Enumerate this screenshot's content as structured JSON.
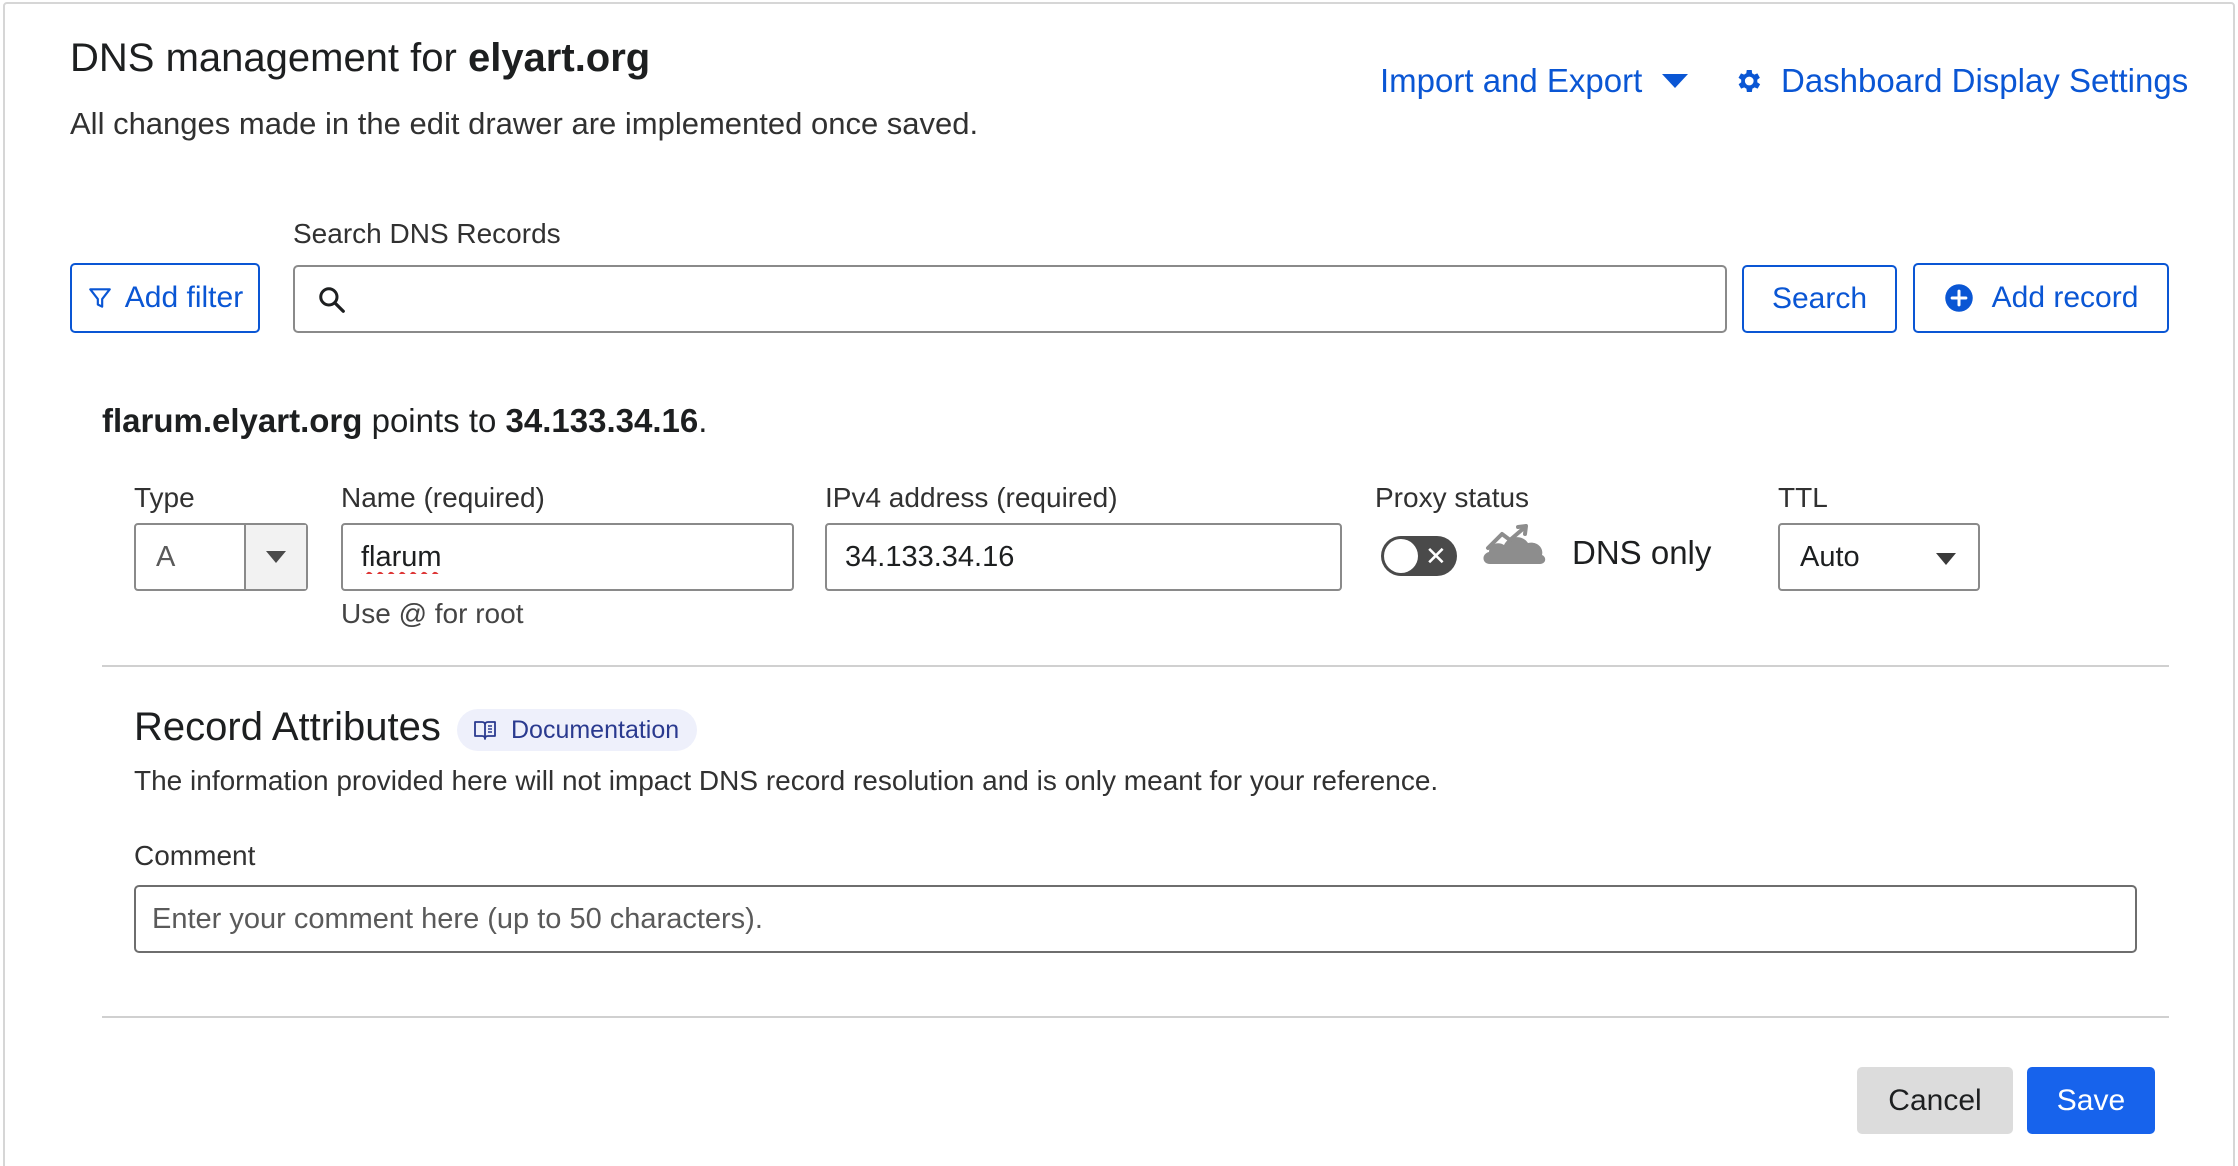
{
  "header": {
    "title_prefix": "DNS management for ",
    "domain": "elyart.org",
    "subtitle": "All changes made in the edit drawer are implemented once saved.",
    "import_export_label": "Import and Export",
    "dashboard_settings_label": "Dashboard Display Settings"
  },
  "search": {
    "label": "Search DNS Records",
    "value": "",
    "placeholder": "",
    "add_filter_label": "Add filter",
    "search_button_label": "Search",
    "add_record_label": "Add record"
  },
  "record": {
    "summary_host": "flarum.elyart.org",
    "summary_middle": " points to ",
    "summary_ip": "34.133.34.16",
    "summary_end": ".",
    "type_label": "Type",
    "type_value": "A",
    "name_label": "Name (required)",
    "name_value": "flarum",
    "name_hint": "Use @ for root",
    "ipv4_label": "IPv4 address (required)",
    "ipv4_value": "34.133.34.16",
    "proxy_label": "Proxy status",
    "proxy_value": "DNS only",
    "ttl_label": "TTL",
    "ttl_value": "Auto"
  },
  "attributes": {
    "title": "Record Attributes",
    "documentation_label": "Documentation",
    "description": "The information provided here will not impact DNS record resolution and is only meant for your reference.",
    "comment_label": "Comment",
    "comment_value": "",
    "comment_placeholder": "Enter your comment here (up to 50 characters)."
  },
  "actions": {
    "cancel_label": "Cancel",
    "save_label": "Save"
  },
  "colors": {
    "link_blue": "#0a56d4",
    "primary_button": "#1763ec",
    "cancel_button": "#dcdcdc",
    "toggle_off": "#4a4a4a",
    "doc_badge_bg": "#eef0fb"
  }
}
